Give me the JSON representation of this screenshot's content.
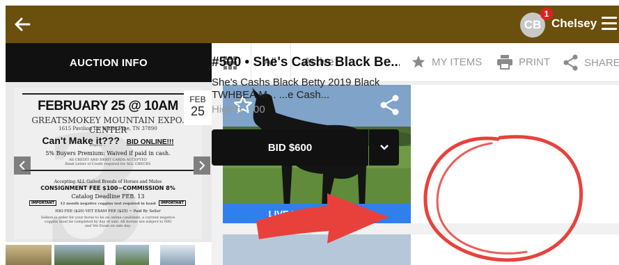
{
  "header": {
    "avatar_initials": "CB",
    "notification_count": "1",
    "username": "Chelsey",
    "bar_color": "#6b4f0c"
  },
  "left": {
    "title": "AUCTION INFO",
    "date_month": "FEB",
    "date_day": "25",
    "flyer": {
      "headline": "FEBRUARY 25 @ 10AM",
      "venue": "GREATSMOKEY MOUNTAIN EXPO. CENTER",
      "address": "1615 Pavilion Dr. White Pine, TN 37890",
      "cant_make_it": "Can't Make it???",
      "bid_online": "BID ONLINE!!!",
      "bid_url": "https://…",
      "premium": "5% Buyers Premium: Waived if paid in cash.",
      "payment_note": "All CREDIT AND DEBIT CARDS ACCEPTED",
      "bank_note": "Bank Letter of Credit required for ALL CHECKS",
      "breeds": "Accepting ALL Gaited Breeds of Horses and Mules",
      "consignment": "CONSIGNMENT FEE $100~COMMISSION 8%",
      "catalog": "Catalog Deadline FEB. 13",
      "important_1": "IMPORTANT",
      "coggins": "12 month negative coggins test required in hand",
      "important_2": "IMPORTANT",
      "fees": "HIO FEE ($20) VET EXAM FEE ($25) ~ Paid By Seller",
      "fine_print_1": "Sellers is order for your horse to be an online candidate, a current negative",
      "fine_print_2": "coggins must be completed by day of sale. All horses are subject to HIO",
      "fine_print_3": "and Vet Exam on sale day."
    }
  },
  "filters": {
    "all": "All",
    "active": "Active",
    "my_items": "MY ITEMS",
    "print": "PRINT",
    "share": "SHARE"
  },
  "lot": {
    "title": "#500 • She's Cashs Black Be...",
    "description": "She's Cashs Black Betty 2019 Black TWHBEA M... ...e Cash...",
    "high_bid": "High b... 00",
    "live_in": "LIVE IN 25d 12h 29min",
    "bid_label": "BID $600"
  },
  "colors": {
    "live_bar": "#2f80ed",
    "bid_button": "#111111",
    "annotation_red": "#e8413c"
  }
}
